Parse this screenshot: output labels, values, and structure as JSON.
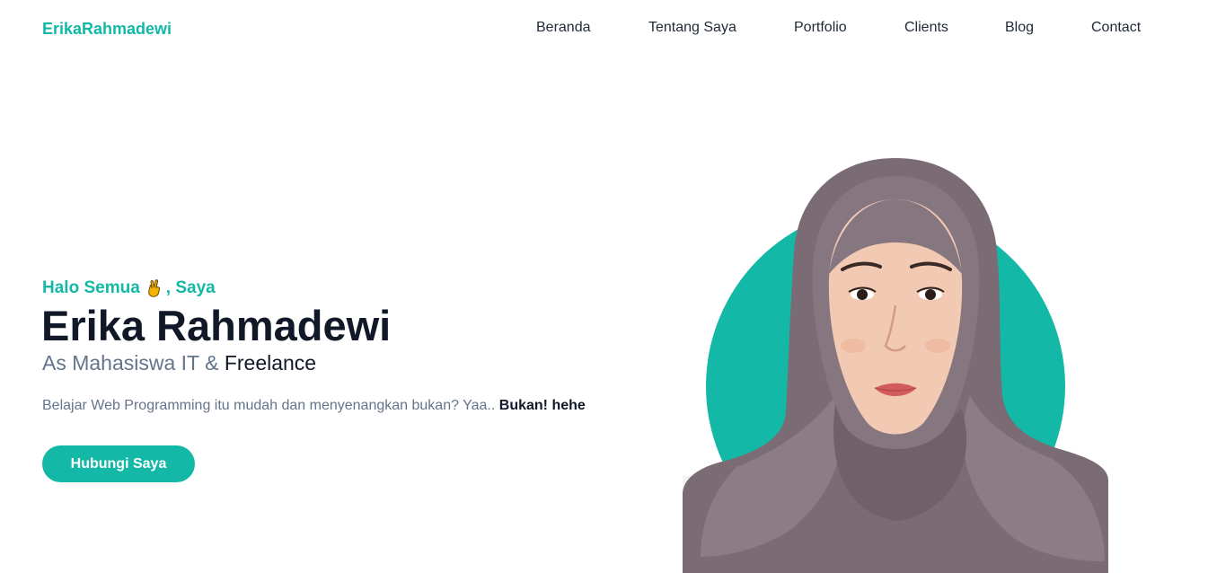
{
  "navbar": {
    "brand": "ErikaRahmadewi",
    "links": [
      "Beranda",
      "Tentang Saya",
      "Portfolio",
      "Clients",
      "Blog",
      "Contact"
    ]
  },
  "hero": {
    "greeting_prefix": "Halo Semua",
    "greeting_emoji": "crossed-fingers-icon",
    "greeting_suffix": ", Saya",
    "name": "Erika Rahmadewi",
    "role_prefix": "As Mahasiswa IT &",
    "role_highlight": "Freelance",
    "description": "Belajar Web Programming itu mudah dan menyenangkan bukan? Yaa..",
    "description_bold": "Bukan! hehe",
    "cta_label": "Hubungi Saya"
  },
  "colors": {
    "accent": "#14b8a6",
    "heading": "#111827",
    "muted": "#64748b"
  }
}
